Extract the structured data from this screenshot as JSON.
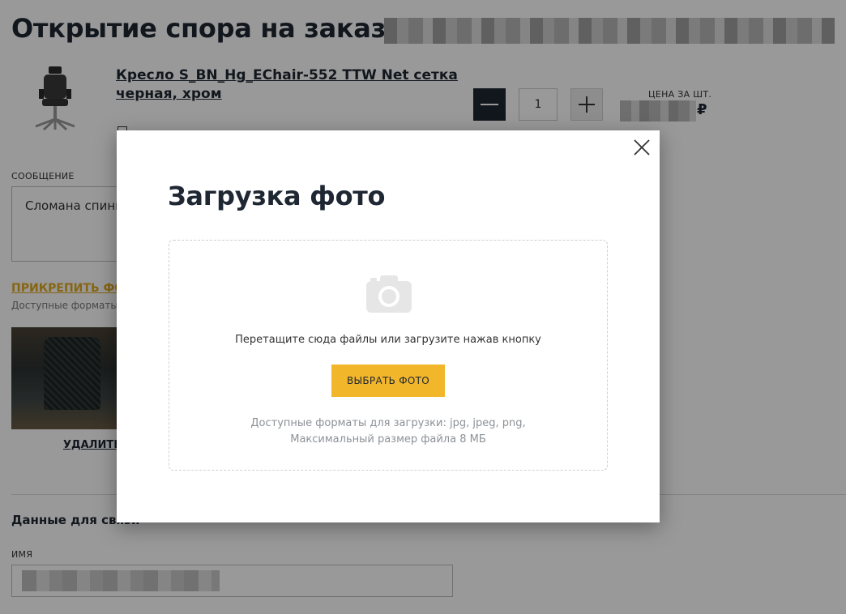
{
  "page": {
    "title": "Открытие спора на заказ",
    "product_name": "Кресло S_BN_Hg_EChair-552 TTW Net сетка черная, хром",
    "quantity": "1",
    "price_label": "ЦЕНА ЗА ШТ.",
    "price_currency": "₽",
    "message_label": "СООБЩЕНИЕ",
    "message_value": "Сломана спинка",
    "attach_link": "ПРИКРЕПИТЬ ФОТО",
    "formats_hint": "Доступные форматы для загрузки",
    "delete_link": "УДАЛИТЬ",
    "contacts_heading": "Данные для связи",
    "name_label": "ИМЯ"
  },
  "modal": {
    "title": "Загрузка фото",
    "drop_text": "Перетащите сюда файлы или загрузите нажав кнопку",
    "choose_button": "ВЫБРАТЬ ФОТО",
    "formats_line1": "Доступные форматы для загрузки: jpg, jpeg, png,",
    "formats_line2": "Максимальный размер файла 8 МБ",
    "close_icon": "close-icon",
    "camera_icon": "camera-icon"
  },
  "colors": {
    "accent": "#f2b62b",
    "dark": "#1f2733",
    "overlay": "rgba(0,0,0,0.40)"
  }
}
